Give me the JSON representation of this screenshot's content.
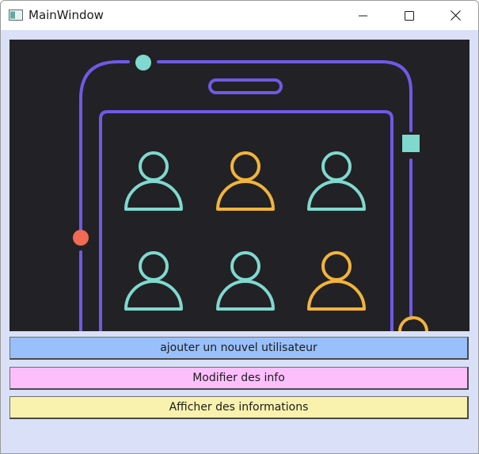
{
  "window": {
    "title": "MainWindow",
    "controls": {
      "minimize_icon": "minimize-icon",
      "maximize_icon": "maximize-icon",
      "close_icon": "close-icon"
    }
  },
  "illustration": {
    "icon": "user-group-illustration",
    "colors": {
      "background": "#222126",
      "frame": "#6f5ae6",
      "teal": "#7fd9ce",
      "yellow": "#f2b43a",
      "coral": "#f06a55"
    },
    "user_figures": [
      "teal",
      "yellow",
      "teal",
      "teal",
      "teal",
      "yellow"
    ]
  },
  "buttons": {
    "add_label": "ajouter un nouvel utilisateur",
    "edit_label": "Modifier des info",
    "show_label": "Afficher des informations"
  },
  "colors": {
    "client_bg": "#d9e0f7",
    "add_button": "#99c0fb",
    "edit_button": "#fdbffc",
    "show_button": "#f8f2ae"
  }
}
